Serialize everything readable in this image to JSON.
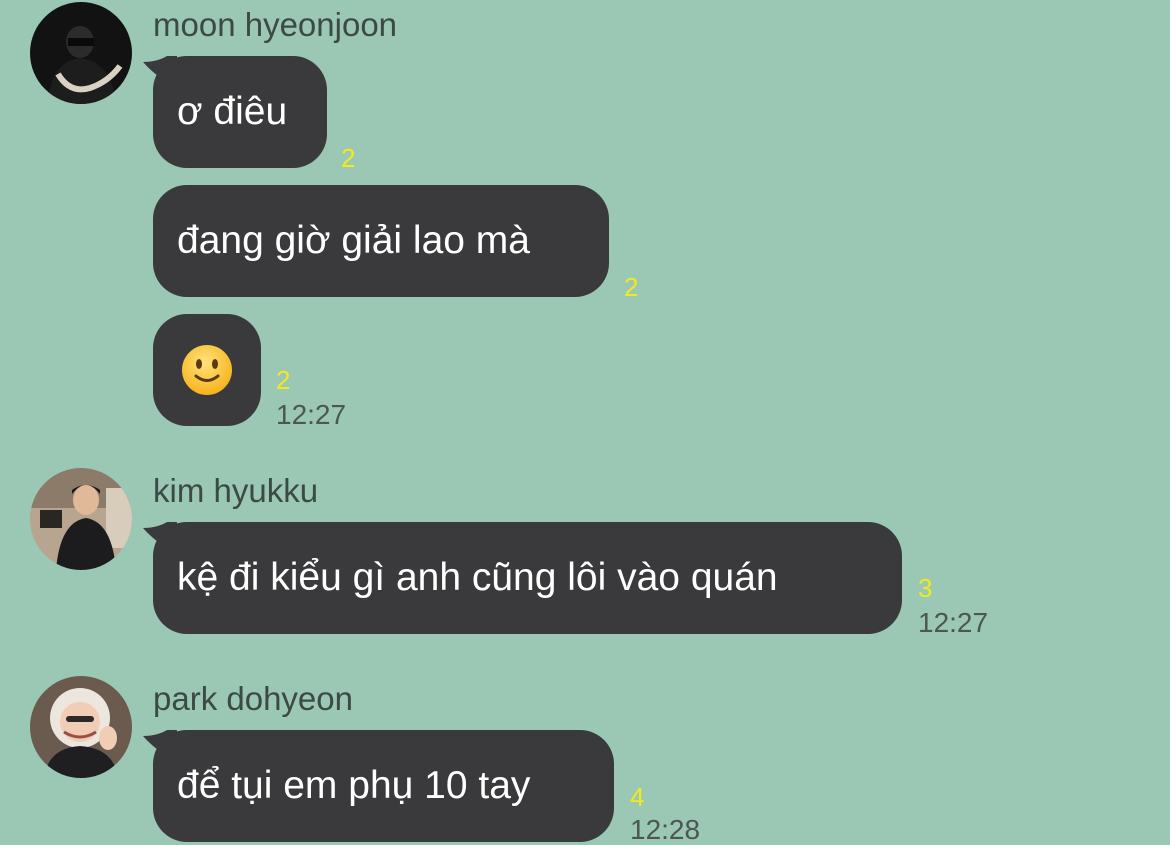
{
  "messages": [
    {
      "sender": "moon hyeonjoon",
      "avatar": "profile-photo",
      "bubbles": [
        {
          "text": "ơ điêu",
          "read": "2"
        },
        {
          "text": "đang giờ giải lao mà",
          "read": "2"
        },
        {
          "emoji": "slightly-smiling-face",
          "read": "2",
          "time": "12:27"
        }
      ]
    },
    {
      "sender": "kim hyukku",
      "avatar": "profile-photo",
      "bubbles": [
        {
          "text": "kệ đi kiểu gì anh cũng lôi vào quán",
          "read": "3",
          "time": "12:27"
        }
      ]
    },
    {
      "sender": "park dohyeon",
      "avatar": "profile-photo",
      "bubbles": [
        {
          "text": "để tụi em phụ 10 tay",
          "read": "4",
          "time": "12:28"
        }
      ]
    }
  ],
  "colors": {
    "background": "#9bc7b5",
    "bubble": "#3a3a3c",
    "read_count": "#f2ea1c"
  }
}
